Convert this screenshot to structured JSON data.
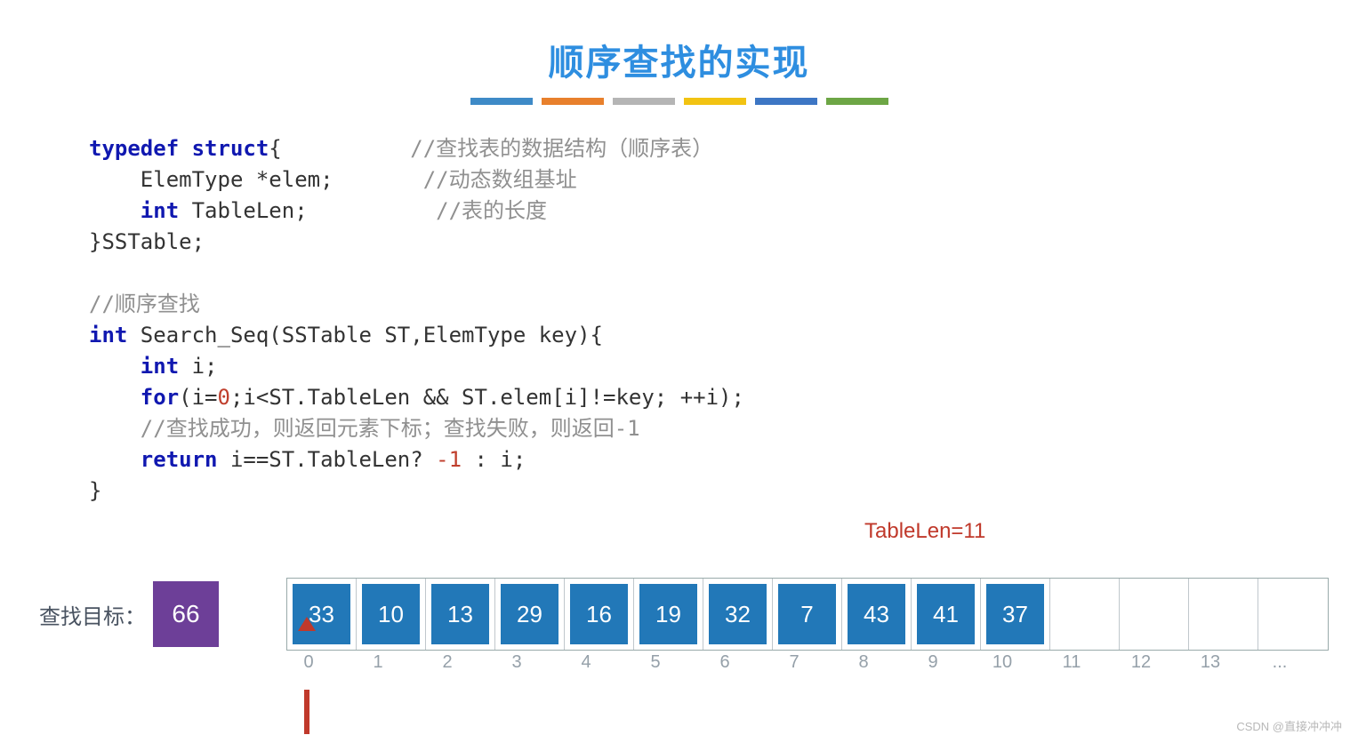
{
  "title": "顺序查找的实现",
  "bar_colors": [
    "#3E8AC7",
    "#E8802C",
    "#B5B5B5",
    "#F2C312",
    "#3D76C4",
    "#6DA645"
  ],
  "code": {
    "l1_kw": "typedef struct",
    "l1_rest": "{",
    "l1_comment": "//查找表的数据结构（顺序表）",
    "l2_indent": "    ElemType *elem;",
    "l2_comment": "//动态数组基址",
    "l3_indent_kw": "    int",
    "l3_rest": " TableLen;",
    "l3_comment": "//表的长度",
    "l4": "}SSTable;",
    "l5_comment": "//顺序查找",
    "l6_kw": "int",
    "l6_rest": " Search_Seq(SSTable ST,ElemType key){",
    "l7_kw": "    int",
    "l7_rest": " i;",
    "l8_kw": "    for",
    "l8_a": "(i=",
    "l8_zero": "0",
    "l8_b": ";i<ST.TableLen && ST.elem[i]!=key; ++i);",
    "l9_comment": "    //查找成功，则返回元素下标；查找失败，则返回-1",
    "l10_kw": "    return",
    "l10_a": " i==ST.TableLen? ",
    "l10_neg1": "-1",
    "l10_b": " : i;",
    "l11": "}"
  },
  "tablelen_label": "TableLen=11",
  "target_label": "查找目标：",
  "target_value": "66",
  "array": [
    "33",
    "10",
    "13",
    "29",
    "16",
    "19",
    "32",
    "7",
    "43",
    "41",
    "37",
    "",
    "",
    "",
    ""
  ],
  "indices": [
    "0",
    "1",
    "2",
    "3",
    "4",
    "5",
    "6",
    "7",
    "8",
    "9",
    "10",
    "11",
    "12",
    "13",
    "..."
  ],
  "arrow_index": 0,
  "watermark": "CSDN @直接冲冲冲"
}
